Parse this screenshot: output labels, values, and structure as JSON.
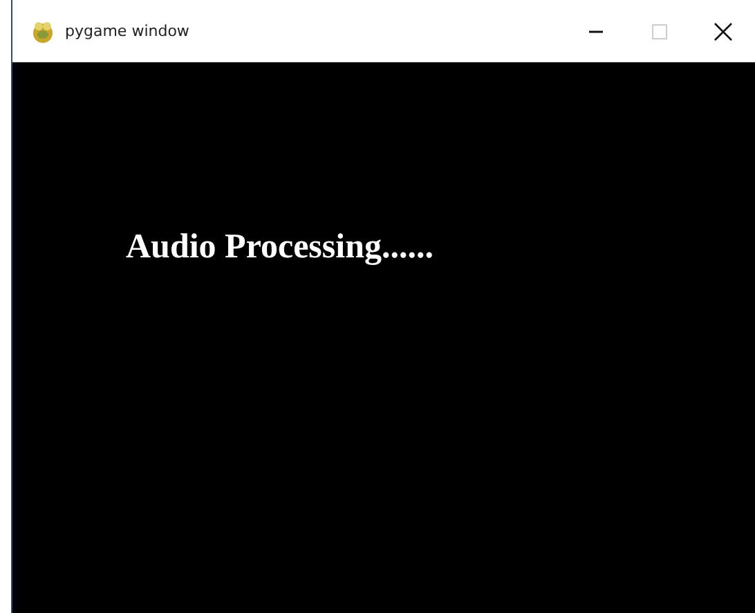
{
  "window": {
    "title": "pygame window",
    "maximize_disabled": true
  },
  "canvas": {
    "message": "Audio Processing......"
  }
}
